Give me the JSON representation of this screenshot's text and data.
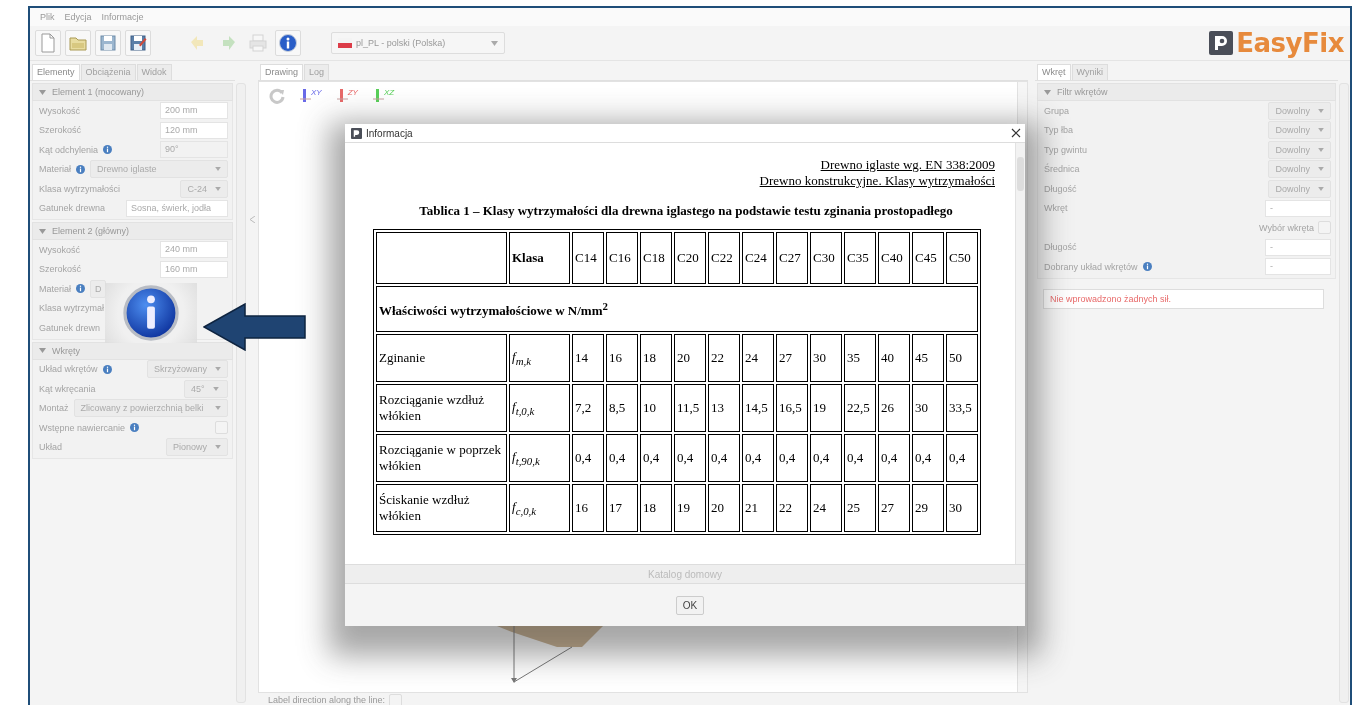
{
  "menu": [
    "Plik",
    "Edycja",
    "Informacje"
  ],
  "toolbar": {
    "buttons": [
      {
        "kind": "new",
        "disabled": false
      },
      {
        "kind": "open",
        "disabled": false
      },
      {
        "kind": "save",
        "disabled": false
      },
      {
        "kind": "save-as",
        "disabled": false
      },
      {
        "kind": "undo",
        "disabled": true
      },
      {
        "kind": "redo",
        "disabled": true
      },
      {
        "kind": "print",
        "disabled": true
      },
      {
        "kind": "info",
        "disabled": false
      }
    ],
    "language": "pl_PL - polski (Polska)",
    "logo": "EasyFix"
  },
  "left_panel": {
    "tabs": [
      {
        "label": "Elementy",
        "selected": true
      },
      {
        "label": "Obciążenia",
        "selected": false
      },
      {
        "label": "Widok",
        "selected": false
      }
    ],
    "sections": [
      {
        "title": "Element 1 (mocowany)",
        "expanded": true,
        "rows": [
          {
            "kind": "text",
            "label": "Wysokość",
            "value": "200 mm"
          },
          {
            "kind": "text",
            "label": "Szerokość",
            "value": "120 mm"
          },
          {
            "kind": "readonly",
            "label": "Kąt odchylenia",
            "info": true,
            "value": "90°"
          },
          {
            "kind": "select-wide",
            "label": "Materiał",
            "info": true,
            "value": "Drewno iglaste"
          },
          {
            "kind": "select",
            "label": "Klasa wytrzymałości",
            "value": "C-24"
          },
          {
            "kind": "text-wide",
            "label": "Gatunek drewna",
            "value": "Sosna, świerk, jodła"
          }
        ]
      },
      {
        "title": "Element 2 (główny)",
        "expanded": true,
        "rows": [
          {
            "kind": "text",
            "label": "Wysokość",
            "value": "240 mm"
          },
          {
            "kind": "text",
            "label": "Szerokość",
            "value": "160 mm"
          },
          {
            "kind": "covered-select",
            "label": "Materiał",
            "info": true,
            "value": "D"
          },
          {
            "kind": "covered",
            "label": "Klasa wytrzymał"
          },
          {
            "kind": "covered",
            "label": "Gatunek drewn"
          }
        ]
      },
      {
        "title": "Wkręty",
        "expanded": true,
        "rows": [
          {
            "kind": "select",
            "label": "Układ wkrętów",
            "info": true,
            "value": "Skrzyżowany"
          },
          {
            "kind": "select",
            "label": "Kąt wkręcania",
            "value": "45°"
          },
          {
            "kind": "select-wide",
            "label": "Montaż",
            "value": "Zlicowany z powierzchnią belki"
          },
          {
            "kind": "checkbox",
            "label": "Wstępne nawiercanie",
            "info": true,
            "checked": false
          },
          {
            "kind": "select",
            "label": "Układ",
            "value": "Pionowy"
          }
        ]
      }
    ]
  },
  "center": {
    "tabs": [
      {
        "label": "Drawing",
        "selected": true
      },
      {
        "label": "Log",
        "selected": false
      }
    ],
    "views": [
      {
        "label": "XY",
        "color": "#6a6ae8"
      },
      {
        "label": "ZY",
        "color": "#e86a6a"
      },
      {
        "label": "XZ",
        "color": "#5ad05a"
      }
    ],
    "label_direction": {
      "label": "Label direction along the line:",
      "checked": false
    }
  },
  "right_panel": {
    "tabs": [
      {
        "label": "Wkręt",
        "selected": true
      },
      {
        "label": "Wyniki",
        "selected": false
      }
    ],
    "section": {
      "title": "Filtr wkrętów",
      "expanded": true,
      "rows": [
        {
          "kind": "select",
          "label": "Grupa",
          "value": "Dowolny"
        },
        {
          "kind": "select",
          "label": "Typ łba",
          "value": "Dowolny"
        },
        {
          "kind": "select",
          "label": "Typ gwintu",
          "value": "Dowolny"
        },
        {
          "kind": "select",
          "label": "Średnica",
          "value": "Dowolny"
        },
        {
          "kind": "select",
          "label": "Długość",
          "value": "Dowolny"
        },
        {
          "kind": "text",
          "label": "Wkręt",
          "value": "-",
          "option": {
            "label": "Wybór wkręta",
            "checked": false
          }
        },
        {
          "kind": "text",
          "label": "Długość",
          "value": "-"
        },
        {
          "kind": "text",
          "label": "Dobrany układ wkrętów",
          "info": true,
          "value": "-"
        }
      ]
    },
    "message": "Nie wprowadzono żadnych sił."
  },
  "dialog": {
    "title": "Informacja",
    "document": {
      "header": [
        "Drewno iglaste wg. EN 338:2009",
        "Drewno konstrukcyjne. Klasy wytrzymałości"
      ],
      "title": "Tablica 1 – Klasy wytrzymałości dla drewna iglastego na podstawie testu zginania prostopadłego",
      "table": {
        "header_label": "Klasa",
        "classes": [
          "C14",
          "C16",
          "C18",
          "C20",
          "C22",
          "C24",
          "C27",
          "C30",
          "C35",
          "C40",
          "C45",
          "C50"
        ],
        "rows": [
          {
            "kind": "section",
            "label": "Właściwości wytrzymałościowe w N/mm$^{2}$"
          },
          {
            "kind": "data",
            "label": "Zginanie",
            "symbol": "f$_{m,k}$",
            "values": [
              "14",
              "16",
              "18",
              "20",
              "22",
              "24",
              "27",
              "30",
              "35",
              "40",
              "45",
              "50"
            ]
          },
          {
            "kind": "data",
            "label": "Rozciąganie wzdłuż włókien",
            "symbol": "f$_{t,0,k}$",
            "values": [
              "7,2",
              "8,5",
              "10",
              "11,5",
              "13",
              "14,5",
              "16,5",
              "19",
              "22,5",
              "26",
              "30",
              "33,5"
            ]
          },
          {
            "kind": "data",
            "label": "Rozciąganie w poprzek włókien",
            "symbol": "f$_{t,90,k}$",
            "values": [
              "0,4",
              "0,4",
              "0,4",
              "0,4",
              "0,4",
              "0,4",
              "0,4",
              "0,4",
              "0,4",
              "0,4",
              "0,4",
              "0,4"
            ]
          },
          {
            "kind": "data",
            "label": "Ściskanie wzdłuż włókien",
            "symbol": "f$_{c,0,k}$",
            "values": [
              "16",
              "17",
              "18",
              "19",
              "20",
              "21",
              "22",
              "24",
              "25",
              "27",
              "29",
              "30"
            ]
          }
        ]
      }
    },
    "footer": "Katalog domowy",
    "button": "OK"
  }
}
